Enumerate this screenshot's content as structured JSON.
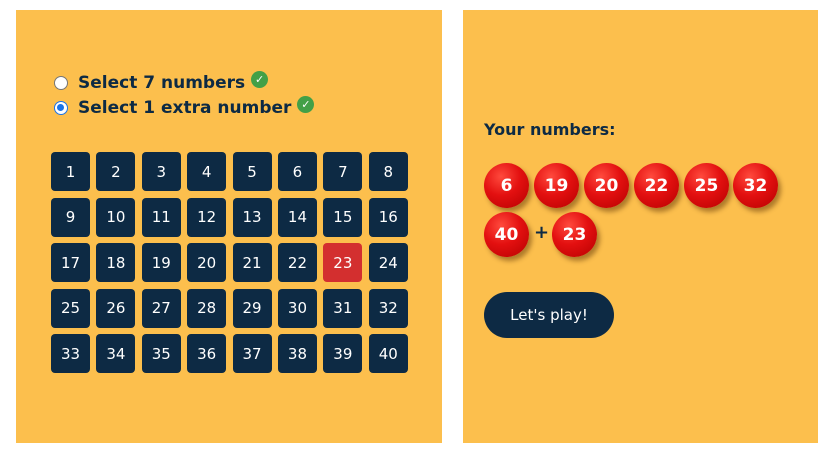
{
  "modes": [
    {
      "label": "Select 7 numbers",
      "checked": false,
      "done": true
    },
    {
      "label": "Select 1 extra number",
      "checked": true,
      "done": true
    }
  ],
  "grid": {
    "numbers": [
      1,
      2,
      3,
      4,
      5,
      6,
      7,
      8,
      9,
      10,
      11,
      12,
      13,
      14,
      15,
      16,
      17,
      18,
      19,
      20,
      21,
      22,
      23,
      24,
      25,
      26,
      27,
      28,
      29,
      30,
      31,
      32,
      33,
      34,
      35,
      36,
      37,
      38,
      39,
      40
    ],
    "highlighted": [
      23
    ]
  },
  "summary": {
    "label": "Your numbers:",
    "main_numbers": [
      "6",
      "19",
      "20",
      "22",
      "25",
      "32",
      "40"
    ],
    "plus": "+",
    "extra_number": "23"
  },
  "play_button": {
    "label": "Let's play!"
  },
  "colors": {
    "panel": "#fcbf4d",
    "navy": "#0d2a44",
    "selected_cell": "#d32f2f",
    "ball": "#e31010",
    "check": "#43a047"
  },
  "icons": {
    "done": "check-circle-icon"
  }
}
